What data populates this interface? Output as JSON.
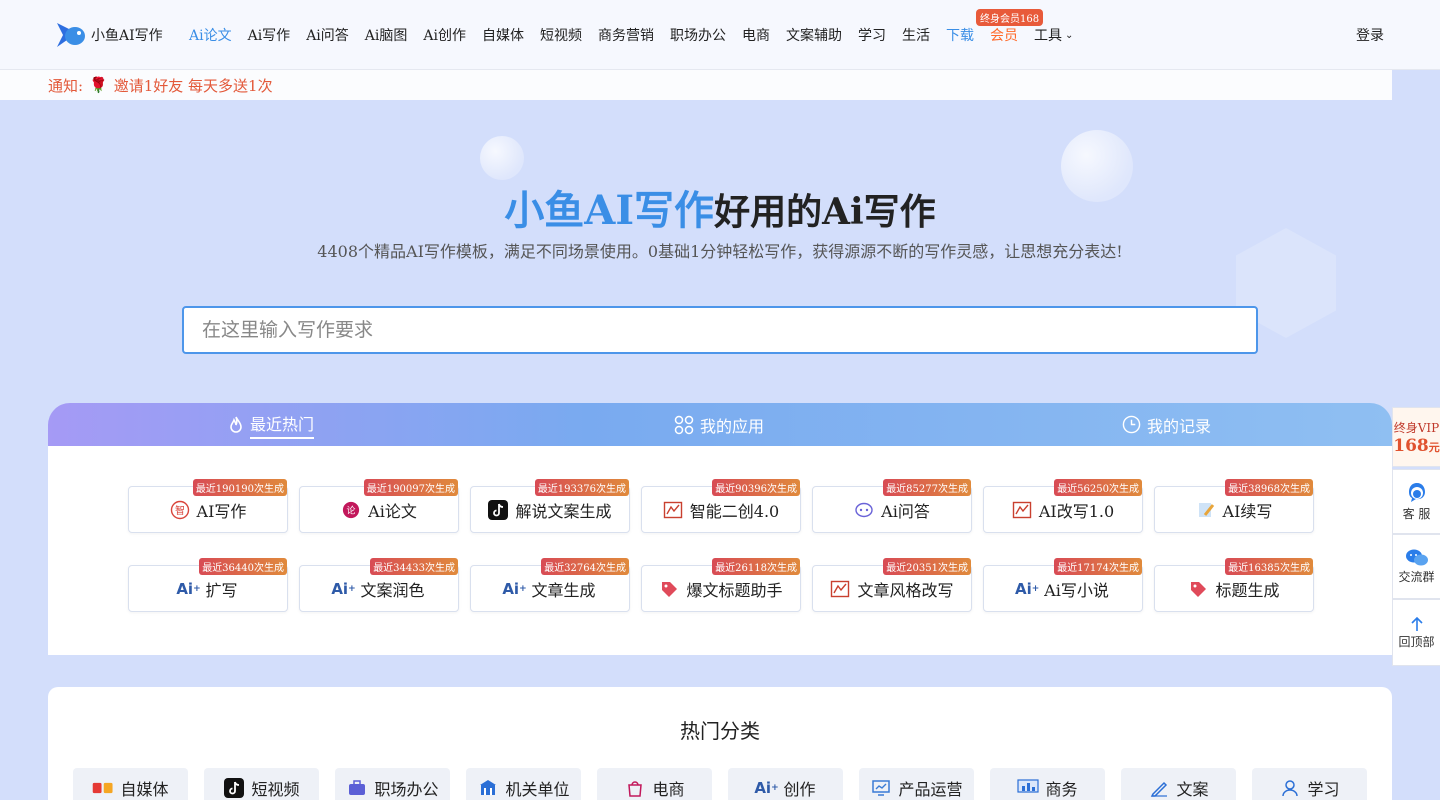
{
  "header": {
    "logo_text": "小鱼AI写作",
    "nav": [
      {
        "label": "Ai论文",
        "state": "active"
      },
      {
        "label": "Ai写作",
        "state": ""
      },
      {
        "label": "Ai问答",
        "state": ""
      },
      {
        "label": "Ai脑图",
        "state": ""
      },
      {
        "label": "Ai创作",
        "state": ""
      },
      {
        "label": "自媒体",
        "state": ""
      },
      {
        "label": "短视频",
        "state": ""
      },
      {
        "label": "商务营销",
        "state": ""
      },
      {
        "label": "职场办公",
        "state": ""
      },
      {
        "label": "电商",
        "state": ""
      },
      {
        "label": "文案辅助",
        "state": ""
      },
      {
        "label": "学习",
        "state": ""
      },
      {
        "label": "生活",
        "state": ""
      },
      {
        "label": "下载",
        "state": "download"
      },
      {
        "label": "会员",
        "state": "vip"
      }
    ],
    "tools_label": "工具",
    "vip_badge": "终身会员168",
    "login": "登录"
  },
  "notice": {
    "prefix": "通知:",
    "icon": "rose-icon",
    "text": "邀请1好友 每天多送1次"
  },
  "hero": {
    "brand": "小鱼AI写作",
    "title_rest": "好用的Ai写作",
    "subtitle": "4408个精品AI写作模板，满足不同场景使用。0基础1分钟轻松写作，获得源源不断的写作灵感，让思想充分表达!",
    "search_placeholder": "在这里输入写作要求"
  },
  "tabs": [
    {
      "label": "最近热门",
      "icon": "flame-icon"
    },
    {
      "label": "我的应用",
      "icon": "apps-icon"
    },
    {
      "label": "我的记录",
      "icon": "clock-icon"
    }
  ],
  "cards": [
    {
      "label": "AI写作",
      "badge": "最近190190次生成",
      "icon": "zhi-icon"
    },
    {
      "label": "Ai论文",
      "badge": "最近190097次生成",
      "icon": "lun-icon"
    },
    {
      "label": "解说文案生成",
      "badge": "最近193376次生成",
      "icon": "tiktok-icon"
    },
    {
      "label": "智能二创4.0",
      "badge": "最近90396次生成",
      "icon": "rewrite-icon"
    },
    {
      "label": "Ai问答",
      "badge": "最近85277次生成",
      "icon": "chat-icon"
    },
    {
      "label": "AI改写1.0",
      "badge": "最近56250次生成",
      "icon": "rewrite-icon"
    },
    {
      "label": "AI续写",
      "badge": "最近38968次生成",
      "icon": "pencil-icon"
    },
    {
      "label": "扩写",
      "badge": "最近36440次生成",
      "icon": "ai-spark-icon"
    },
    {
      "label": "文案润色",
      "badge": "最近34433次生成",
      "icon": "ai-spark-icon"
    },
    {
      "label": "文章生成",
      "badge": "最近32764次生成",
      "icon": "ai-spark-icon"
    },
    {
      "label": "爆文标题助手",
      "badge": "最近26118次生成",
      "icon": "tag-icon"
    },
    {
      "label": "文章风格改写",
      "badge": "最近20351次生成",
      "icon": "rewrite-icon"
    },
    {
      "label": "Ai写小说",
      "badge": "最近17174次生成",
      "icon": "ai-spark-icon"
    },
    {
      "label": "标题生成",
      "badge": "最近16385次生成",
      "icon": "tag-icon"
    }
  ],
  "categories": {
    "title": "热门分类",
    "items": [
      {
        "label": "自媒体",
        "icon": "media-icon"
      },
      {
        "label": "短视频",
        "icon": "tiktok-icon"
      },
      {
        "label": "职场办公",
        "icon": "briefcase-icon"
      },
      {
        "label": "机关单位",
        "icon": "building-icon"
      },
      {
        "label": "电商",
        "icon": "shop-icon"
      },
      {
        "label": "创作",
        "icon": "ai-spark-icon"
      },
      {
        "label": "产品运营",
        "icon": "monitor-icon"
      },
      {
        "label": "商务",
        "icon": "chart-board-icon"
      },
      {
        "label": "文案",
        "icon": "pen-icon"
      },
      {
        "label": "学习",
        "icon": "person-icon"
      }
    ]
  },
  "sidebar": {
    "vip_line1": "终身VIP",
    "vip_price": "168",
    "vip_unit": "元",
    "service": "客 服",
    "group": "交流群",
    "top": "回顶部"
  },
  "colors": {
    "accent": "#3a8ee6",
    "vip": "#ff6a2b",
    "badge": "#d84b55"
  }
}
